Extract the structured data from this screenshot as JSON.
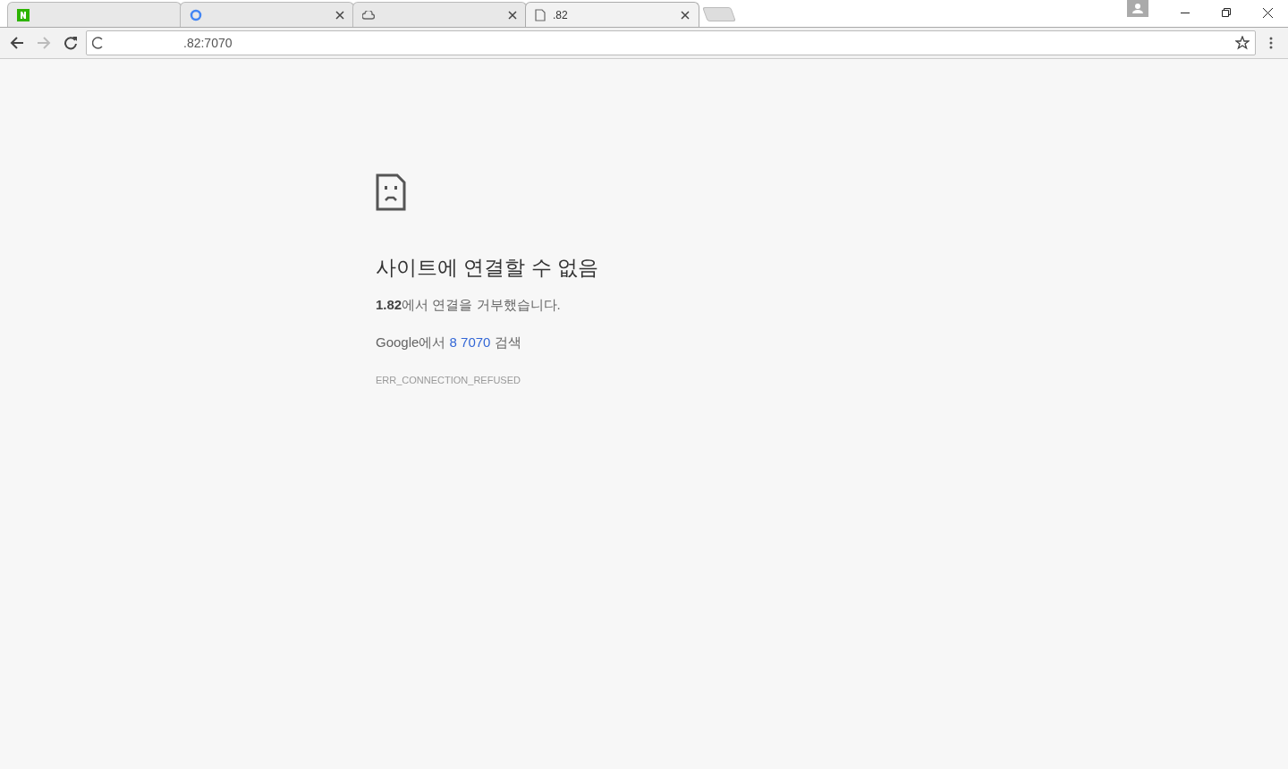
{
  "tabs": [
    {
      "kind": "naver",
      "selected": false
    },
    {
      "kind": "google",
      "selected": false
    },
    {
      "kind": "cloud",
      "selected": false
    },
    {
      "kind": "page",
      "title": ".82",
      "selected": true
    }
  ],
  "address_bar": {
    "url": ".82:7070"
  },
  "error": {
    "heading": "사이트에 연결할 수 없음",
    "message": "**1.82**에서 연결을 거부했습니다.",
    "search_prefix": "Google에서 ",
    "search_link": "8 7070",
    "search_suffix": " 검색",
    "code": "ERR_CONNECTION_REFUSED"
  }
}
